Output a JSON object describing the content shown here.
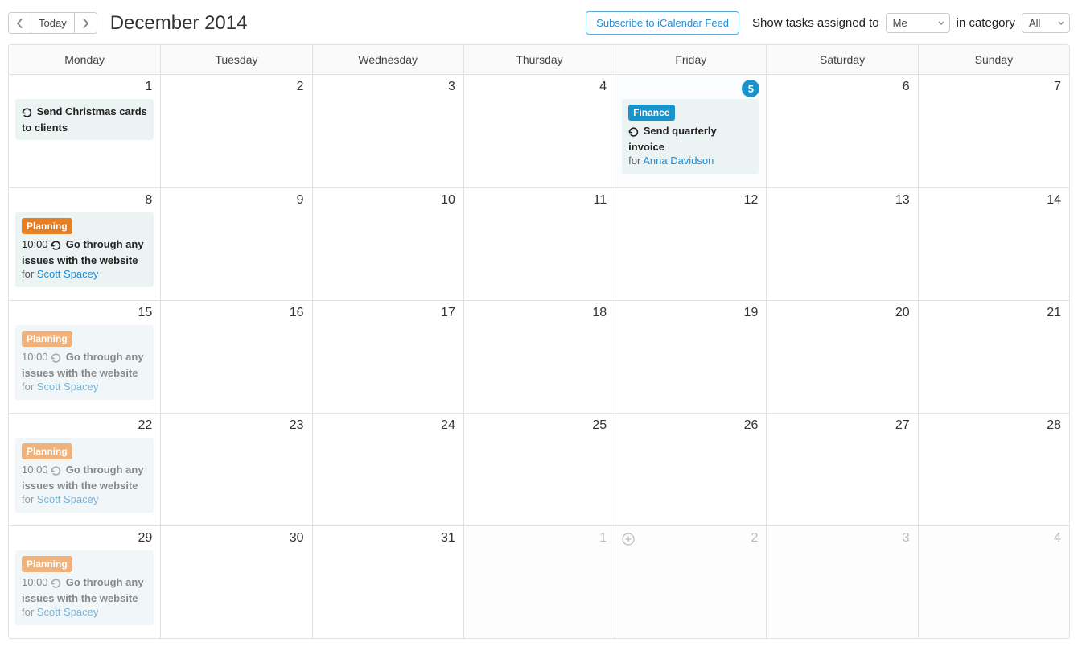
{
  "header": {
    "today_label": "Today",
    "title": "December 2014",
    "subscribe": "Subscribe to iCalendar Feed",
    "filter_prefix": "Show tasks assigned to",
    "filter_assignee": "Me",
    "filter_mid": "in category",
    "filter_category": "All"
  },
  "weekdays": [
    "Monday",
    "Tuesday",
    "Wednesday",
    "Thursday",
    "Friday",
    "Saturday",
    "Sunday"
  ],
  "cells": [
    {
      "day": "1",
      "tasks": [
        {
          "kind": "simple",
          "title": "Send Christmas cards to clients"
        }
      ]
    },
    {
      "day": "2"
    },
    {
      "day": "3"
    },
    {
      "day": "4"
    },
    {
      "day": "5",
      "today": true,
      "tasks": [
        {
          "kind": "tagged",
          "tag": "Finance",
          "tag_cls": "finance",
          "title": "Send quarterly invoice",
          "for": "for",
          "assignee": "Anna Davidson"
        }
      ]
    },
    {
      "day": "6"
    },
    {
      "day": "7"
    },
    {
      "day": "8",
      "tasks": [
        {
          "kind": "planning",
          "tag": "Planning",
          "tag_cls": "planning",
          "time": "10:00",
          "title": "Go through any issues with the website",
          "for": "for",
          "assignee": "Scott Spacey"
        }
      ]
    },
    {
      "day": "9"
    },
    {
      "day": "10"
    },
    {
      "day": "11"
    },
    {
      "day": "12"
    },
    {
      "day": "13"
    },
    {
      "day": "14"
    },
    {
      "day": "15",
      "tasks": [
        {
          "kind": "planning_soft",
          "tag": "Planning",
          "tag_cls": "planning soft",
          "time": "10:00",
          "title": "Go through any issues with the website",
          "for": "for",
          "assignee": "Scott Spacey"
        }
      ]
    },
    {
      "day": "16"
    },
    {
      "day": "17"
    },
    {
      "day": "18"
    },
    {
      "day": "19"
    },
    {
      "day": "20"
    },
    {
      "day": "21"
    },
    {
      "day": "22",
      "tasks": [
        {
          "kind": "planning_soft",
          "tag": "Planning",
          "tag_cls": "planning soft",
          "time": "10:00",
          "title": "Go through any issues with the website",
          "for": "for",
          "assignee": "Scott Spacey"
        }
      ]
    },
    {
      "day": "23"
    },
    {
      "day": "24"
    },
    {
      "day": "25"
    },
    {
      "day": "26"
    },
    {
      "day": "27"
    },
    {
      "day": "28"
    },
    {
      "day": "29",
      "tasks": [
        {
          "kind": "planning_soft",
          "tag": "Planning",
          "tag_cls": "planning soft",
          "time": "10:00",
          "title": "Go through any issues with the website",
          "for": "for",
          "assignee": "Scott Spacey"
        }
      ]
    },
    {
      "day": "30"
    },
    {
      "day": "31"
    },
    {
      "day": "1",
      "next": true
    },
    {
      "day": "2",
      "next": true,
      "add": true
    },
    {
      "day": "3",
      "next": true
    },
    {
      "day": "4",
      "next": true
    }
  ]
}
